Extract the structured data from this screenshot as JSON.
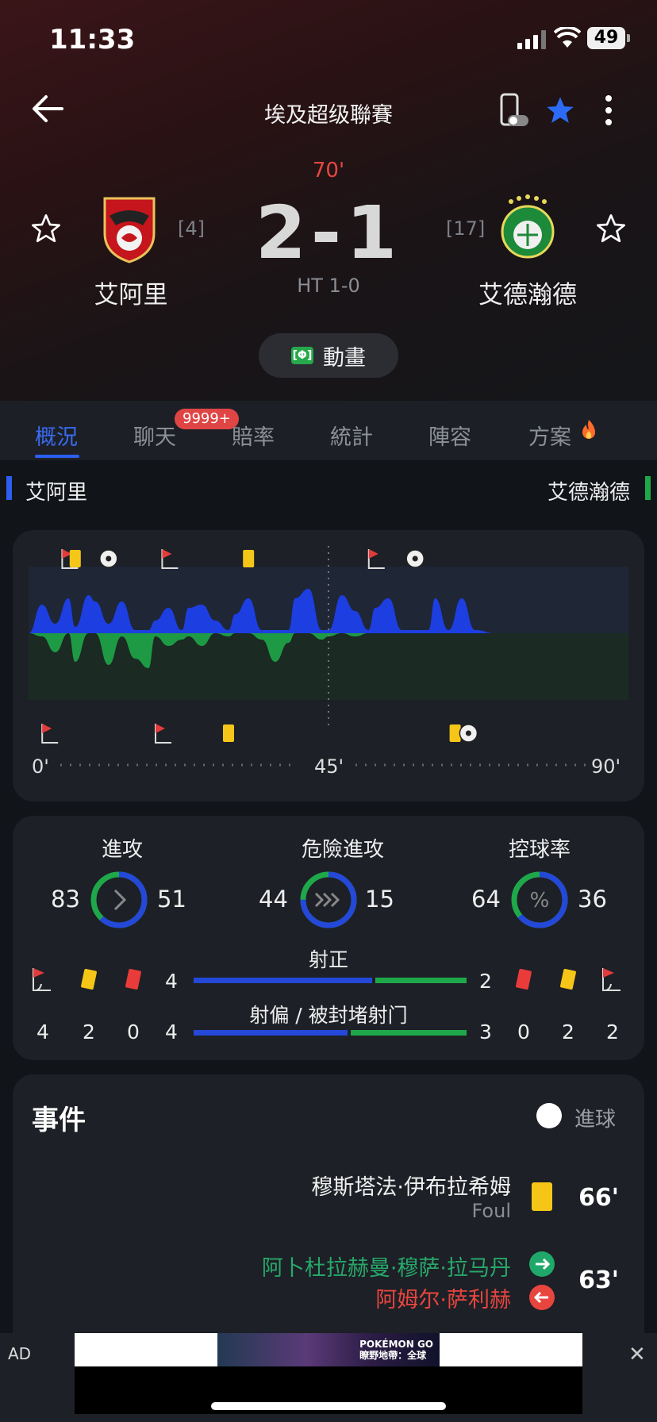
{
  "status": {
    "time": "11:33",
    "battery": "49"
  },
  "nav": {
    "league": "埃及超级聯賽"
  },
  "match": {
    "minute": "70'",
    "score": "2-1",
    "halftime": "HT 1-0",
    "home": {
      "name": "艾阿里",
      "rank": "[4]",
      "color": "#2c5ff0"
    },
    "away": {
      "name": "艾德瀚德",
      "rank": "[17]",
      "color": "#1fa84a"
    },
    "animation_label": "動畫",
    "animation_icon": "[Φ]"
  },
  "tabs": [
    {
      "label": "概況",
      "active": true
    },
    {
      "label": "聊天",
      "badge": "9999+"
    },
    {
      "label": "賠率"
    },
    {
      "label": "統計"
    },
    {
      "label": "陣容"
    },
    {
      "label": "方案"
    }
  ],
  "timeline": {
    "axis": {
      "start": "0'",
      "mid": "45'",
      "end": "90'"
    },
    "home_events": [
      {
        "type": "corner",
        "minute": 6
      },
      {
        "type": "yellow",
        "minute": 7
      },
      {
        "type": "goal",
        "minute": 12
      },
      {
        "type": "corner",
        "minute": 21
      },
      {
        "type": "yellow",
        "minute": 33
      },
      {
        "type": "corner",
        "minute": 52
      },
      {
        "type": "goal",
        "minute": 58
      }
    ],
    "away_events": [
      {
        "type": "corner",
        "minute": 3
      },
      {
        "type": "corner",
        "minute": 20
      },
      {
        "type": "yellow",
        "minute": 30
      },
      {
        "type": "yellow",
        "minute": 64
      },
      {
        "type": "goal",
        "minute": 66
      }
    ]
  },
  "chart_data": {
    "type": "area",
    "x": [
      0,
      2,
      4,
      6,
      7,
      9,
      10,
      12,
      14,
      16,
      18,
      19,
      21,
      23,
      24,
      26,
      28,
      30,
      31,
      33,
      35,
      37,
      39,
      40,
      42,
      44,
      45,
      47,
      49,
      51,
      52,
      54,
      56,
      58,
      60,
      61,
      63,
      65,
      67,
      70
    ],
    "series": [
      {
        "values": [
          0,
          0.45,
          0.15,
          0.55,
          0.1,
          0.6,
          0.5,
          0.15,
          0.5,
          0.05,
          0.05,
          0.2,
          0.4,
          0.05,
          0.4,
          0.45,
          0.2,
          0.05,
          0.3,
          0.55,
          0.05,
          0.05,
          0.05,
          0.55,
          0.7,
          0.05,
          0.05,
          0.6,
          0.35,
          0.05,
          0.4,
          0.55,
          0.05,
          0.05,
          0.05,
          0.55,
          0.05,
          0.55,
          0.05,
          0
        ]
      },
      {
        "values": [
          0,
          -0.05,
          -0.3,
          0,
          -0.45,
          0,
          0,
          -0.5,
          -0.05,
          -0.4,
          -0.55,
          -0.05,
          -0.2,
          -0.1,
          -0.05,
          -0.2,
          0,
          -0.05,
          0,
          0,
          -0.1,
          -0.45,
          -0.15,
          0,
          0,
          -0.1,
          -0.05,
          0,
          -0.05,
          0,
          0,
          0,
          0,
          0,
          0,
          0,
          0,
          0,
          0,
          0
        ]
      }
    ],
    "xlim": [
      0,
      90
    ]
  },
  "stats": [
    {
      "title": "進攻",
      "home": "83",
      "away": "51",
      "home_frac": 0.62,
      "icon": "chevron-right"
    },
    {
      "title": "危險進攻",
      "home": "44",
      "away": "15",
      "home_frac": 0.75,
      "icon": "triple-chevron"
    },
    {
      "title": "控球率",
      "home": "64",
      "away": "36",
      "home_frac": 0.64,
      "icon": "percent"
    }
  ],
  "shots": {
    "on_label": "射正",
    "off_label": "射偏 / 被封堵射门",
    "home_on": "4",
    "away_on": "2",
    "home_on_frac": 0.66,
    "home_off": "4",
    "away_off": "3",
    "home_off_frac": 0.57,
    "home_corners": "4",
    "home_yellow": "2",
    "home_red": "0",
    "away_red": "0",
    "away_yellow": "2",
    "away_corners": "2"
  },
  "events": {
    "title": "事件",
    "goal_filter": "進球",
    "items": [
      {
        "minute": "66'",
        "player": "穆斯塔法·伊布拉希姆",
        "detail": "Foul",
        "type": "yellow-card"
      },
      {
        "minute": "63'",
        "player_in": "阿卜杜拉赫曼·穆萨·拉马丹",
        "player_out": "阿姆尔·萨利赫",
        "type": "substitution"
      }
    ]
  },
  "ad": {
    "tag": "AD",
    "close": "✕",
    "brand": "POKÉMON GO",
    "subtitle": "瞭野地帶：全球"
  }
}
